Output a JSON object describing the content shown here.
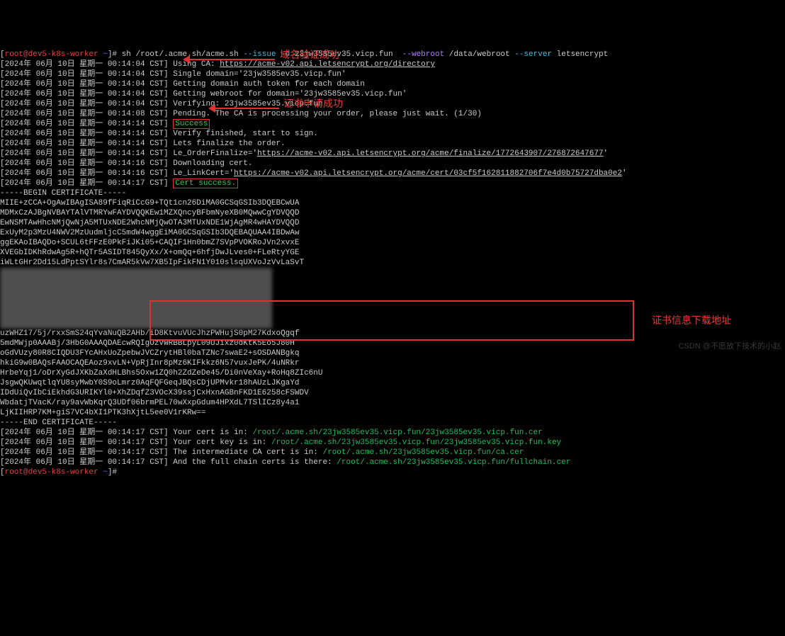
{
  "prompt": {
    "userhost": "root@dev5-k8s-worker",
    "path": "~",
    "symbol": "#"
  },
  "command": {
    "pre": "sh /root/.acme.sh/acme.sh ",
    "arg1": "--issue -d",
    "domain": " 23jw3585ev35.vicp.fun  ",
    "arg2": "--webroot",
    "webroot": " /data/webroot ",
    "arg3": "--server",
    "server": " letsencrypt"
  },
  "ts": {
    "l1": "[2024年 06月 10日 星期一 00:14:04 CST]",
    "l2": "[2024年 06月 10日 星期一 00:14:04 CST]",
    "l3": "[2024年 06月 10日 星期一 00:14:04 CST]",
    "l4": "[2024年 06月 10日 星期一 00:14:04 CST]",
    "l5": "[2024年 06月 10日 星期一 00:14:04 CST]",
    "l6": "[2024年 06月 10日 星期一 00:14:08 CST]",
    "l7": "[2024年 06月 10日 星期一 00:14:14 CST]",
    "l8": "[2024年 06月 10日 星期一 00:14:14 CST]",
    "l9": "[2024年 06月 10日 星期一 00:14:14 CST]",
    "l10": "[2024年 06月 10日 星期一 00:14:14 CST]",
    "l11": "[2024年 06月 10日 星期一 00:14:16 CST]",
    "l12": "[2024年 06月 10日 星期一 00:14:16 CST]",
    "l13": "[2024年 06月 10日 星期一 00:14:17 CST]",
    "l14": "[2024年 06月 10日 星期一 00:14:17 CST]",
    "l15": "[2024年 06月 10日 星期一 00:14:17 CST]",
    "l16": "[2024年 06月 10日 星期一 00:14:17 CST]",
    "l17": "[2024年 06月 10日 星期一 00:14:17 CST]"
  },
  "lines": {
    "using_ca": " Using CA: ",
    "ca_url": "https://acme-v02.api.letsencrypt.org/directory",
    "single_domain": " Single domain='23jw3585ev35.vicp.fun'",
    "auth_token": " Getting domain auth token for each domain",
    "get_webroot": " Getting webroot for domain='23jw3585ev35.vicp.fun'",
    "verifying": " Verifying: 23jw3585ev35.vicp.fun",
    "pending": " Pending. The CA is processing your order, please just wait. (1/30)",
    "success": "Success",
    "verify_finished": " Verify finished, start to sign.",
    "finalize": " Lets finalize the order.",
    "order_finalize": " Le_OrderFinalize='",
    "order_url": "https://acme-v02.api.letsencrypt.org/acme/finalize/1772643907/276872647677",
    "downloading": " Downloading cert.",
    "linkcert": " Le_LinkCert='",
    "linkcert_url": "https://acme-v02.api.letsencrypt.org/acme/cert/03cf5f162811882706f7e4d0b75727dba0e2",
    "cert_success": "Cert success.",
    "begin": "-----BEGIN CERTIFICATE-----",
    "c1": "MIIE+zCCA+OgAwIBAgISA89fFiqRiCcG9+TQt1cn26DiMA0GCSqGSIb3DQEBCwUA",
    "c2": "MDMxCzAJBgNVBAYTAlVTMRYwFAYDVQQKEw1MZXQncyBFbmNyeXB0MQwwCgYDVQQD",
    "c3": "EwNSMTAwHhcNMjQwNjA5MTUxNDE2WhcNMjQwOTA3MTUxNDE1WjAgMR4wHAYDVQQD",
    "c4": "ExUyM2p3MzU4NWV2MzUudmljcC5mdW4wggEiMA0GCSqGSIb3DQEBAQUAA4IBDwAw",
    "c5": "ggEKAoIBAQDo+SCUL6tFFzE0PkFiJKi05+CAQIF1Hn0bmZ7SVpPVOKRoJVn2xvxE",
    "c6": "XVEGbIDKhRdwAg5R+hQTr5ASIDT845QyXx/X+omQq+6hfjDwJLves0+FLeRtyYGE",
    "c7": "iWLtGHr2Dd15LdPptSYlr8s7CmAR5kVw7XB5IpFikFN1Y010slsqUXVoJzVvLaSvT",
    "c8": "uzWHZ17/5j/rxxSmS24qYvaNuQB2AHb/iD8KtvuVUcJhzPWHujS0pM27KdxoQgqf",
    "c9": "5mdMWjp0AAABj/3HbG0AAAQDAEcwRQIgOzVWRBBLpyL09UJixz0dKtK5Eo5J80H",
    "c10": "oGdVUzy80R8CIQDU3FYcAHxUoZpebwJVCZrytHBl0baTZNc7swaE2+sOSDANBgkq",
    "c11": "hkiG9w0BAQsFAAOCAQEAoz9xvLN+VpRjInr8pMz6KIFkkz6N57vuxJePK/4uNRkr",
    "c12": "HrbeYqj1/oDrXyGdJXKbZaXdHLBhs5Oxw1ZQ0h2ZdZeDe45/Di0nVeXay+RoHq8ZIc6nU",
    "c13": "JsgwQKUwqtlqYU8syMwbY0S9oLmrz0AqFQFGeqJBQsCDjUPMvkr18hAUzLJKgaYd",
    "c14": "IDdUiQvIbCiEkhdG3URIKYl0+XhZDqfZ3VOcX39ssjCxHxnAGBnFKD1E6258cFSWDV",
    "c15": "WbdatjTVacK/ray9avWbKqrQ3UDf06brmPEL70wXxpGdum4HPXdL7TSlICz8y4a1",
    "c16": "LjKIIHRP7KM+giS7VC4bXI1PTK3hXjtL5ee0V1rKRw==",
    "end": "-----END CERTIFICATE-----",
    "cert_in": " Your cert is in: ",
    "cert_path": "/root/.acme.sh/23jw3585ev35.vicp.fun/23jw3585ev35.vicp.fun.cer",
    "key_in": " Your cert key is in: ",
    "key_path": "/root/.acme.sh/23jw3585ev35.vicp.fun/23jw3585ev35.vicp.fun.key",
    "ca_in": " The intermediate CA cert is in: ",
    "ca_path": "/root/.acme.sh/23jw3585ev35.vicp.fun/ca.cer",
    "full_in": " And the full chain certs is there: ",
    "full_path": "/root/.acme.sh/23jw3585ev35.vicp.fun/fullchain.cer"
  },
  "ann": {
    "a1": "域名验证成功",
    "a2": "证书申请成功",
    "a3": "证书信息下载地址"
  },
  "watermark": "CSDN @不愿放下技术的小赵"
}
